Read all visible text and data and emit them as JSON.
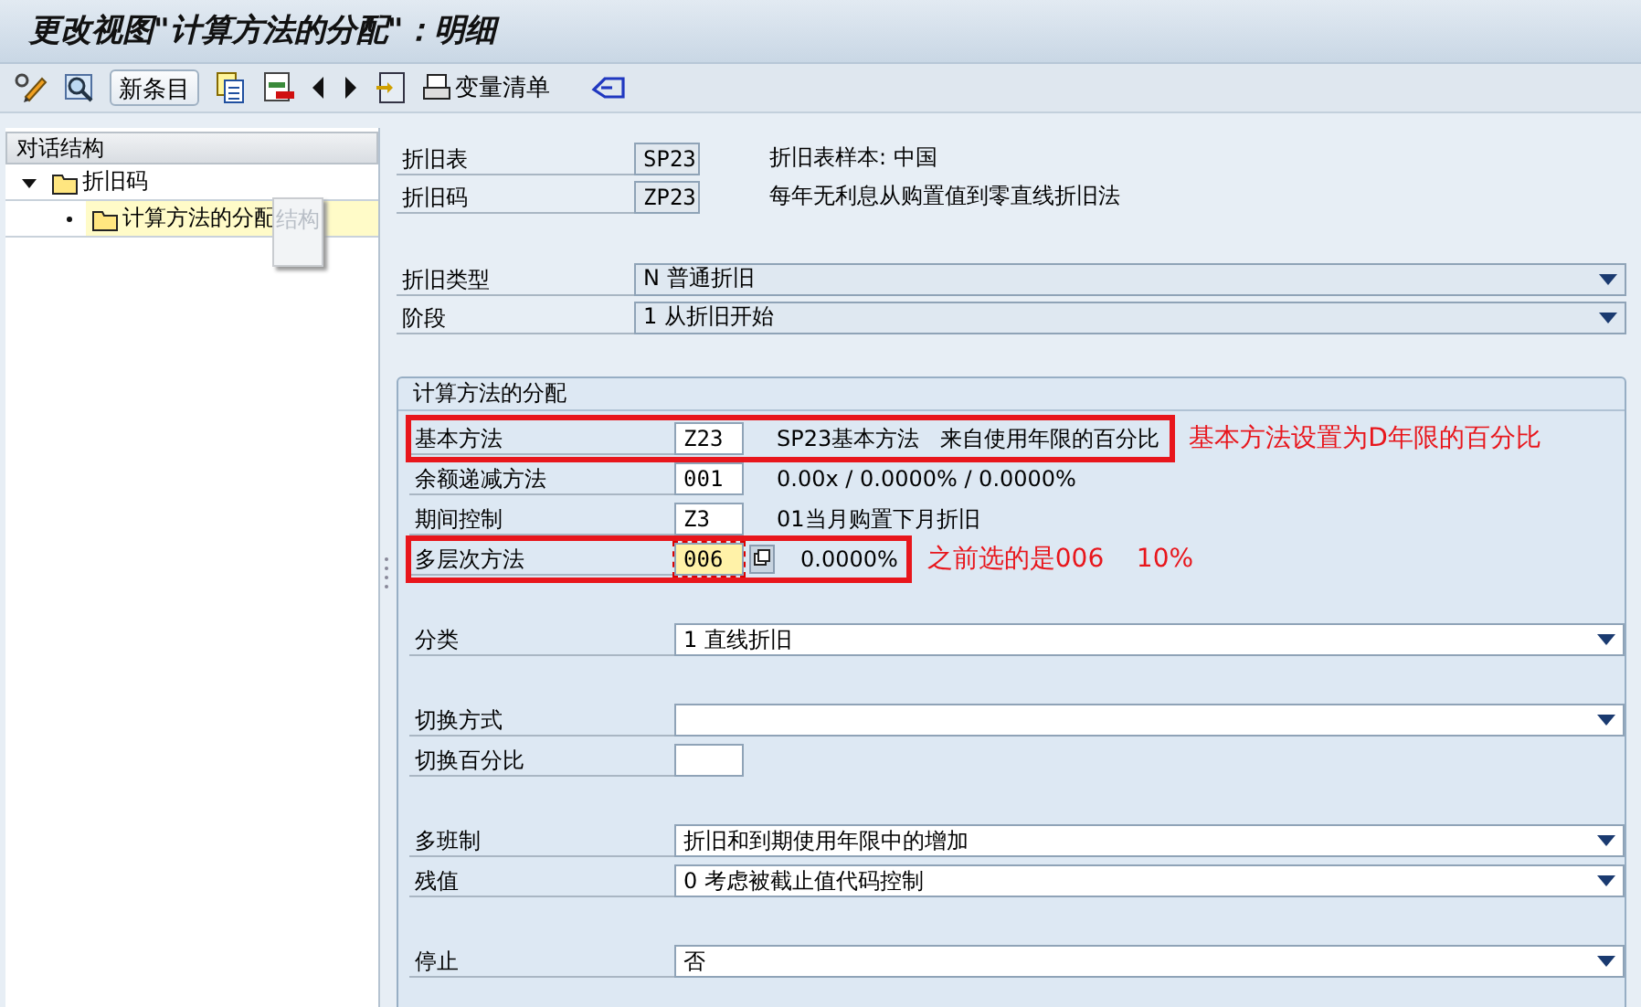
{
  "window": {
    "title": "更改视图\"计算方法的分配\"：明细"
  },
  "toolbar": {
    "new_button": "新条目",
    "variant_list": "变量清单"
  },
  "sidebar": {
    "title": "对话结构",
    "tooltip": "结构",
    "tree": [
      {
        "label": "折旧码",
        "expanded": true,
        "selected": false,
        "children": [
          {
            "label": "计算方法的分配",
            "selected": true
          }
        ]
      }
    ]
  },
  "header_blocks": [
    [
      {
        "label": "折旧表",
        "kind": "display",
        "value": "SP23",
        "description": "折旧表样本: 中国"
      },
      {
        "label": "折旧码",
        "kind": "display",
        "value": "ZP23",
        "description": "每年无利息从购置值到零直线折旧法"
      }
    ],
    [
      {
        "label": "折旧类型",
        "kind": "dropdown",
        "value": "N 普通折旧"
      },
      {
        "label": "阶段",
        "kind": "dropdown",
        "value": "1 从折旧开始"
      }
    ]
  ],
  "group": {
    "title": "计算方法的分配",
    "blocks": [
      [
        {
          "label": "基本方法",
          "kind": "input",
          "value": "Z23",
          "description": "SP23基本方法   来自使用年限的百分比",
          "highlighted": true,
          "annotation": "基本方法设置为D年限的百分比"
        },
        {
          "label": "余额递减方法",
          "kind": "input",
          "value": "001",
          "description": "0.00x / 0.0000% / 0.0000%",
          "highlighted": false
        },
        {
          "label": "期间控制",
          "kind": "input",
          "value": "Z3",
          "description": "01当月购置下月折旧",
          "highlighted": false
        },
        {
          "label": "多层次方法",
          "kind": "input",
          "value": "006",
          "focused": true,
          "value_help": true,
          "description": "0.0000%",
          "highlighted": true,
          "annotation": "之前选的是006    10%"
        }
      ],
      [
        {
          "label": "分类",
          "kind": "short-dropdown",
          "value": "1 直线折旧"
        }
      ],
      [
        {
          "label": "切换方式",
          "kind": "dropdown"
        },
        {
          "label": "切换百分比",
          "kind": "input"
        }
      ],
      [
        {
          "label": "多班制",
          "kind": "dropdown",
          "value": "折旧和到期使用年限中的增加"
        },
        {
          "label": "残值",
          "kind": "dropdown",
          "value": "0 考虑被截止值代码控制"
        }
      ],
      [
        {
          "label": "停止",
          "kind": "dropdown",
          "value": "否"
        }
      ]
    ]
  }
}
